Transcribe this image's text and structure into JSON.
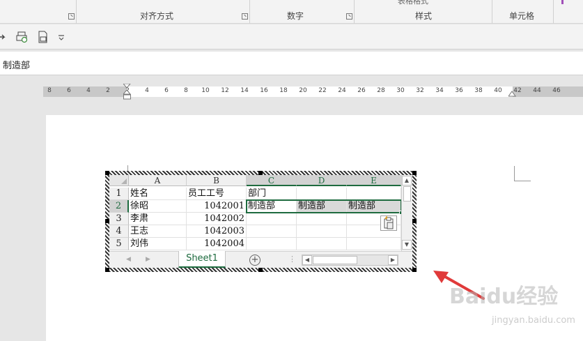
{
  "ribbon": {
    "groups": [
      {
        "label": "",
        "top": ""
      },
      {
        "label": "对齐方式",
        "top": ""
      },
      {
        "label": "数字",
        "top": ""
      },
      {
        "label": "样式",
        "top": "表格格式"
      },
      {
        "label": "单元格",
        "top": ""
      }
    ]
  },
  "formula_bar": {
    "value": "制造部"
  },
  "ruler": {
    "numbers": [
      "8",
      "6",
      "4",
      "2",
      "2",
      "4",
      "6",
      "8",
      "10",
      "12",
      "14",
      "16",
      "18",
      "20",
      "22",
      "24",
      "26",
      "28",
      "30",
      "32",
      "34",
      "36",
      "38",
      "40",
      "42",
      "44",
      "46"
    ]
  },
  "sheet": {
    "columns": [
      "A",
      "B",
      "C",
      "D",
      "E"
    ],
    "rows": [
      "1",
      "2",
      "3",
      "4",
      "5"
    ],
    "cells": [
      [
        "姓名",
        "员工工号",
        "部门",
        "",
        ""
      ],
      [
        "徐昭",
        "1042001",
        "制造部",
        "制造部",
        "制造部"
      ],
      [
        "李肃",
        "1042002",
        "",
        "",
        ""
      ],
      [
        "王志",
        "1042003",
        "",
        "",
        ""
      ],
      [
        "刘伟",
        "1042004",
        "",
        "",
        ""
      ]
    ],
    "active_tab": "Sheet1",
    "add_sheet_symbol": "+",
    "scroll_up": "▲",
    "scroll_down": "▼",
    "scroll_left": "◀",
    "scroll_right": "▶",
    "nav_prev": "◀",
    "nav_next": "▶"
  },
  "watermark": {
    "brand": "Baidu经验",
    "url": "jingyan.baidu.com"
  },
  "colors": {
    "accent": "#1e6b3f",
    "arrow": "#e03a3a"
  }
}
